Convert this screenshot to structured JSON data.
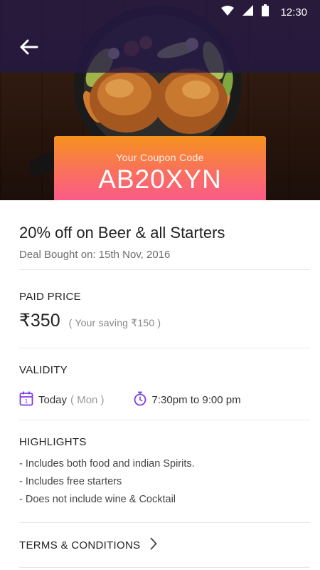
{
  "status_bar": {
    "time": "12:30"
  },
  "coupon": {
    "label": "Your Coupon Code",
    "code": "AB20XYN"
  },
  "deal": {
    "title": "20% off on Beer & all Starters",
    "bought_on": "Deal Bought on: 15th Nov, 2016"
  },
  "price": {
    "heading": "PAID PRICE",
    "amount": "₹350",
    "saving": "( Your saving  ₹150 )"
  },
  "validity": {
    "heading": "VALIDITY",
    "day": "Today",
    "weekday": "( Mon )",
    "time_range": "7:30pm to 9:00 pm"
  },
  "highlights": {
    "heading": "HIGHLIGHTS",
    "items": [
      "- Includes both food and indian Spirits.",
      "- Includes free starters",
      "- Does not include wine & Cocktail"
    ]
  },
  "terms": {
    "label": "TERMS & CONDITIONS"
  },
  "colors": {
    "accent_purple": "#7b3fe4",
    "coupon_top": "#f6921e",
    "coupon_bottom": "#fb5a8a",
    "overlay": "#231846"
  },
  "icons": {
    "back": "arrow-left-icon",
    "wifi": "wifi-icon",
    "signal": "cell-signal-icon",
    "battery": "battery-icon",
    "calendar": "calendar-icon",
    "timer": "stopwatch-icon",
    "chevron": "chevron-right-icon"
  }
}
